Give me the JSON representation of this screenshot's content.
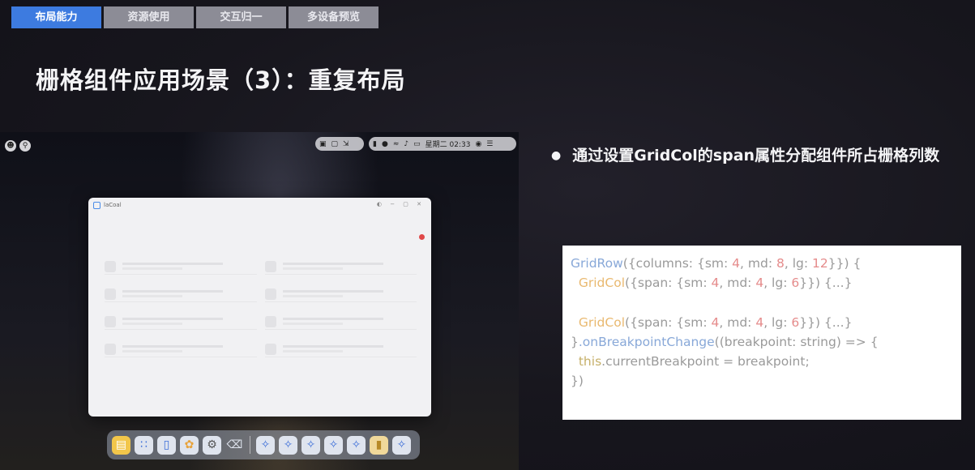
{
  "tabs": [
    {
      "label": "布局能力",
      "active": true
    },
    {
      "label": "资源使用",
      "active": false
    },
    {
      "label": "交互归一",
      "active": false
    },
    {
      "label": "多设备预览",
      "active": false
    }
  ],
  "title": "栅格组件应用场景（3）：重复布局",
  "screen": {
    "window_name": "laCoal",
    "status_time": "星期二 02:33",
    "dock_apps": [
      "folder-app",
      "grid-app",
      "book-app",
      "photos-app",
      "settings-app",
      "trash-app",
      "clover-app",
      "clover-app",
      "clover-app",
      "clover-app",
      "clover-app",
      "notes-app",
      "clover-app"
    ]
  },
  "bullet": "通过设置GridCol的span属性分配组件所占栅格列数",
  "code": {
    "l1_fn": "GridRow",
    "l1_a": "({columns: {sm: ",
    "l1_n1": "4",
    "l1_b": ", md: ",
    "l1_n2": "8",
    "l1_c": ", lg: ",
    "l1_n3": "12",
    "l1_d": "}}) {",
    "l2_fn": "GridCol",
    "l2_a": "({span: {sm: ",
    "l2_n1": "4",
    "l2_b": ", md: ",
    "l2_n2": "4",
    "l2_c": ", lg: ",
    "l2_n3": "6",
    "l2_d": "}}) {...}",
    "l4_fn": "GridCol",
    "l4_a": "({span: {sm: ",
    "l4_n1": "4",
    "l4_b": ", md: ",
    "l4_n2": "4",
    "l4_c": ", lg: ",
    "l4_n3": "6",
    "l4_d": "}}) {...}",
    "l5_a": "}",
    "l5_fn": ".onBreakpointChange",
    "l5_b": "((breakpoint: string) => {",
    "l6_kw": "this",
    "l6_a": ".currentBreakpoint = breakpoint;",
    "l7_a": "})"
  },
  "colors": {
    "tab_active": "#3d7be0",
    "tab_inactive": "#8c8c96",
    "code_number": "#e58b8b",
    "code_function": "#88a8d8"
  }
}
